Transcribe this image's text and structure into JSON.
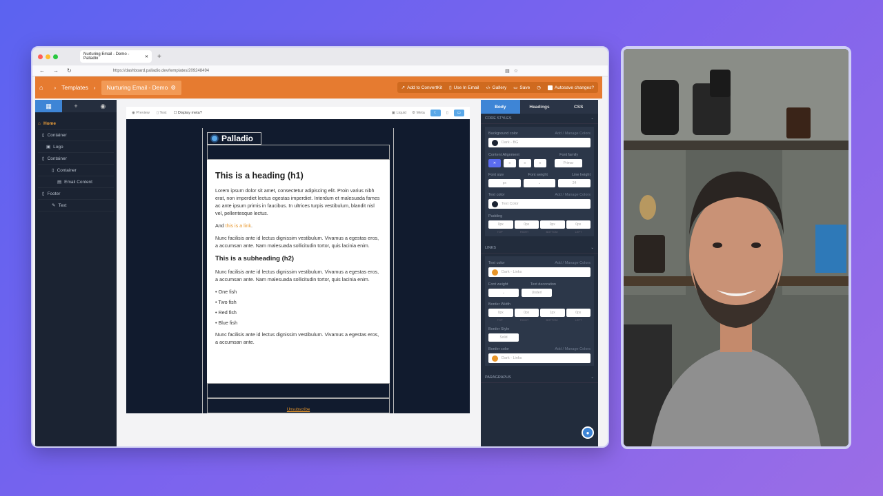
{
  "browser": {
    "tab_title": "Nurturing Email - Demo - Palladio",
    "url": "https://dashboard.palladio.dev/templates/209248494"
  },
  "header": {
    "templates": "Templates",
    "current": "Nurturing Email - Demo",
    "add_convertkit": "Add to ConvertKit",
    "use_in_email": "Use In Email",
    "gallery": "Gallery",
    "save": "Save",
    "autosave": "Autosave changes?"
  },
  "tree": {
    "home": "Home",
    "items": [
      "Container",
      "Logo",
      "Container",
      "Container",
      "Email Content",
      "Footer",
      "Text"
    ]
  },
  "toolbar": {
    "preview": "Preview",
    "test": "Test",
    "meta_toggle": "Display meta?",
    "liquid": "Liquid",
    "meta": "Meta"
  },
  "email": {
    "logo": "Palladio",
    "h1": "This is a heading (h1)",
    "p1": "Lorem ipsum dolor sit amet, consectetur adipiscing elit. Proin varius nibh erat, non imperdiet lectus egestas imperdiet. Interdum et malesuada fames ac ante ipsum primis in faucibus. In ultrices turpis vestibulum, blandit nisl vel, pellentesque lectus.",
    "and": "And ",
    "link": "this is a link",
    "dot": ".",
    "p2": "Nunc facilisis ante id lectus dignissim vestibulum. Vivamus a egestas eros, a accumsan ante. Nam malesuada sollicitudin tortor, quis lacinia enim.",
    "h2": "This is a subheading (h2)",
    "p3": "Nunc facilisis ante id lectus dignissim vestibulum. Vivamus a egestas eros, a accumsan ante. Nam malesuada sollicitudin tortor, quis lacinia enim.",
    "list": [
      "One fish",
      "Two fish",
      "Red fish",
      "Blue fish"
    ],
    "p4": "Nunc facilisis ante id lectus dignissim vestibulum. Vivamus a egestas eros, a accumsan ante.",
    "unsubscribe": "Unsubscribe"
  },
  "panel": {
    "tabs": [
      "Body",
      "Headings",
      "CSS"
    ],
    "core": "Core styles",
    "bg_label": "Background color",
    "manage": "Add / Manage Colors",
    "bg_value": "Dark - BG",
    "align": "Content Alignment",
    "font_family": "Font family",
    "font_family_val": "Primar",
    "font_size": "Font size",
    "font_weight": "Font weight",
    "line_height": "Line height",
    "px": "px",
    "lh_val": "24",
    "text_color": "Text color",
    "text_color_val": "Text Color",
    "padding": "Padding",
    "pad_vals": [
      "0px",
      "0px",
      "0px",
      "0px"
    ],
    "pad_labels": [
      "TOP",
      "RIGHT",
      "BOTTOM",
      "LEFT"
    ],
    "links": "Links",
    "link_color_val": "Dark - Links",
    "text_decoration": "Text decoration",
    "deco_val": "Underl",
    "border_width": "Border Width",
    "bw_vals": [
      "0px",
      "0px",
      "1px",
      "0px"
    ],
    "border_style": "Border Style",
    "bs_val": "Solid",
    "border_color": "Border color",
    "paragraphs": "Paragraphs"
  },
  "colors": {
    "orange": "#e67b30",
    "dark_bg": "#111b2e",
    "link": "#e8962a"
  }
}
